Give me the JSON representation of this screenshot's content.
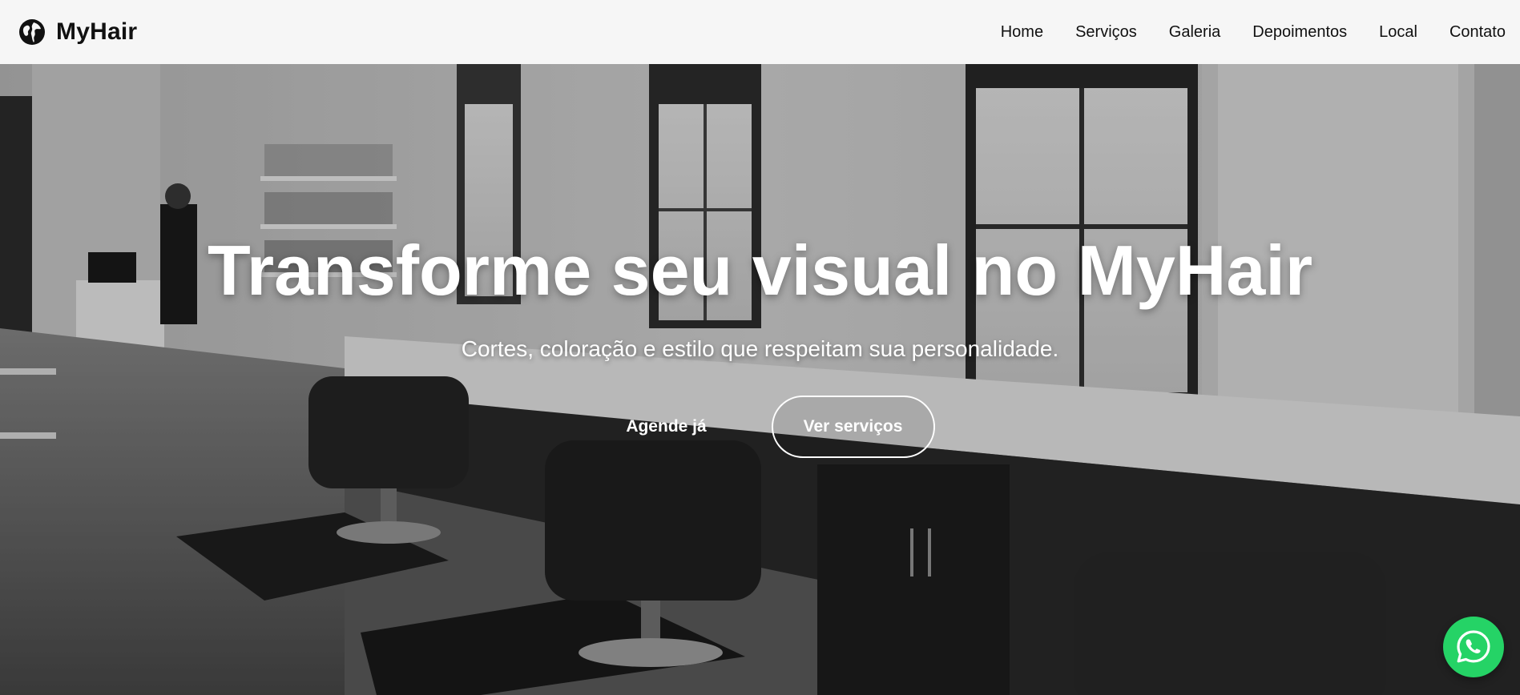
{
  "brand": {
    "name": "MyHair",
    "logo_icon": "globe-icon"
  },
  "nav": {
    "items": [
      {
        "label": "Home"
      },
      {
        "label": "Serviços"
      },
      {
        "label": "Galeria"
      },
      {
        "label": "Depoimentos"
      },
      {
        "label": "Local"
      },
      {
        "label": "Contato"
      }
    ]
  },
  "hero": {
    "title": "Transforme seu visual no MyHair",
    "subtitle": "Cortes, coloração e estilo que respeitam sua personalidade.",
    "primary_button": "Agende já",
    "secondary_button": "Ver serviços",
    "background_image": "black-and-white-hair-salon-interior"
  },
  "whatsapp": {
    "icon": "whatsapp-icon",
    "color": "#25d366"
  },
  "colors": {
    "navbar_bg": "#f6f6f6",
    "text_dark": "#111111",
    "hero_text": "#ffffff"
  }
}
